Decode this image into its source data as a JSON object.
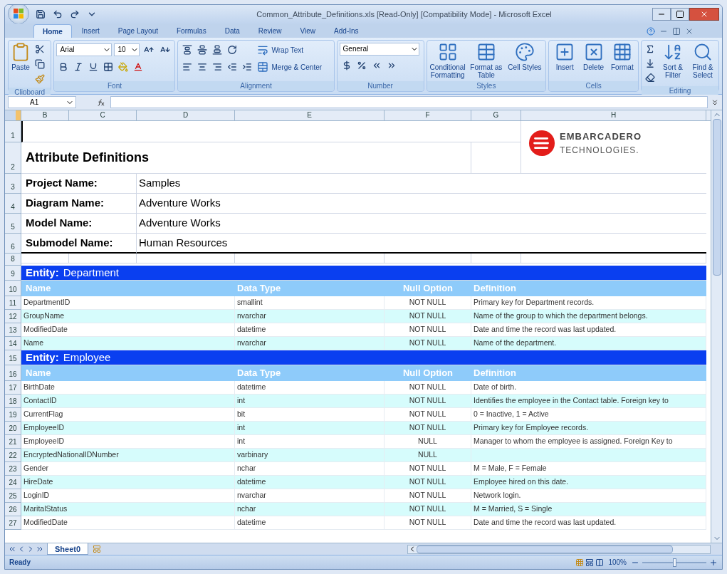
{
  "window": {
    "title": "Common_Attribute_Definitions.xls  [Read-Only]  [Compatibility Mode] - Microsoft Excel"
  },
  "ribbon_tabs": [
    {
      "label": "Home",
      "selected": true
    },
    {
      "label": "Insert",
      "selected": false
    },
    {
      "label": "Page Layout",
      "selected": false
    },
    {
      "label": "Formulas",
      "selected": false
    },
    {
      "label": "Data",
      "selected": false
    },
    {
      "label": "Review",
      "selected": false
    },
    {
      "label": "View",
      "selected": false
    },
    {
      "label": "Add-Ins",
      "selected": false
    }
  ],
  "clipboard": {
    "paste": "Paste",
    "label": "Clipboard"
  },
  "font": {
    "name": "Arial",
    "size": "10",
    "label": "Font"
  },
  "alignment": {
    "wrap": "Wrap Text",
    "merge": "Merge & Center",
    "label": "Alignment"
  },
  "number": {
    "format": "General",
    "label": "Number"
  },
  "styles": {
    "buttons": [
      "Conditional Formatting",
      "Format as Table",
      "Cell Styles"
    ],
    "label": "Styles"
  },
  "cells": {
    "buttons": [
      "Insert",
      "Delete",
      "Format"
    ],
    "label": "Cells"
  },
  "editing": {
    "buttons": [
      "Sort & Filter",
      "Find & Select"
    ],
    "label": "Editing"
  },
  "name_box": "A1",
  "columns": [
    "B",
    "C",
    "D",
    "E",
    "F",
    "G",
    "H"
  ],
  "rows": [
    {
      "row": "1",
      "kind": "top",
      "logo": {
        "line1": "EMBARCADERO",
        "line2": "TECHNOLOGIES."
      }
    },
    {
      "row": "2",
      "kind": "title",
      "text": "Attribute Definitions"
    },
    {
      "row": "3",
      "kind": "field",
      "label": "Project Name:",
      "value": "Samples"
    },
    {
      "row": "4",
      "kind": "field",
      "label": "Diagram Name:",
      "value": "Adventure Works"
    },
    {
      "row": "5",
      "kind": "field",
      "label": "Model Name:",
      "value": "Adventure Works"
    },
    {
      "row": "6",
      "kind": "field",
      "label": "Submodel Name:",
      "value": "Human Resources"
    },
    {
      "row": "8",
      "kind": "spacer"
    },
    {
      "row": "9",
      "kind": "entity",
      "label": "Entity:",
      "value": "Department"
    },
    {
      "row": "10",
      "kind": "header",
      "name": "Name",
      "type": "Data Type",
      "null": "Null Option",
      "definition": "Definition"
    },
    {
      "row": "11",
      "kind": "data",
      "shaded": false,
      "name": "DepartmentID",
      "type": "smallint",
      "null": "NOT NULL",
      "definition": "Primary key for Department records."
    },
    {
      "row": "12",
      "kind": "data",
      "shaded": true,
      "name": "GroupName",
      "type": "nvarchar",
      "null": "NOT NULL",
      "definition": "Name of the group to which the department belongs."
    },
    {
      "row": "13",
      "kind": "data",
      "shaded": false,
      "name": "ModifiedDate",
      "type": "datetime",
      "null": "NOT NULL",
      "definition": "Date and time the record was last updated."
    },
    {
      "row": "14",
      "kind": "data",
      "shaded": true,
      "name": "Name",
      "type": "nvarchar",
      "null": "NOT NULL",
      "definition": "Name of the department."
    },
    {
      "row": "15",
      "kind": "entity",
      "label": "Entity:",
      "value": "Employee"
    },
    {
      "row": "16",
      "kind": "header",
      "name": "Name",
      "type": "Data Type",
      "null": "Null Option",
      "definition": "Definition"
    },
    {
      "row": "17",
      "kind": "data",
      "shaded": false,
      "name": "BirthDate",
      "type": "datetime",
      "null": "NOT NULL",
      "definition": "Date of birth."
    },
    {
      "row": "18",
      "kind": "data",
      "shaded": true,
      "name": "ContactID",
      "type": "int",
      "null": "NOT NULL",
      "definition": "Identifies the employee in the Contact table. Foreign key to"
    },
    {
      "row": "19",
      "kind": "data",
      "shaded": false,
      "name": "CurrentFlag",
      "type": "bit",
      "null": "NOT NULL",
      "definition": "0 = Inactive, 1 = Active"
    },
    {
      "row": "20",
      "kind": "data",
      "shaded": true,
      "name": "EmployeeID",
      "type": "int",
      "null": "NOT NULL",
      "definition": "Primary key for Employee records."
    },
    {
      "row": "21",
      "kind": "data",
      "shaded": false,
      "name": "EmployeeID",
      "type": "int",
      "null": "NULL",
      "definition": "Manager to whom the employee is assigned. Foreign Key to"
    },
    {
      "row": "22",
      "kind": "data",
      "shaded": true,
      "name": "EncryptedNationalIDNumber",
      "type": "varbinary",
      "null": "NULL"
    },
    {
      "row": "23",
      "kind": "data",
      "shaded": false,
      "name": "Gender",
      "type": "nchar",
      "null": "NOT NULL",
      "definition": "M = Male, F = Female"
    },
    {
      "row": "24",
      "kind": "data",
      "shaded": true,
      "name": "HireDate",
      "type": "datetime",
      "null": "NOT NULL",
      "definition": "Employee hired on this date."
    },
    {
      "row": "25",
      "kind": "data",
      "shaded": false,
      "name": "LoginID",
      "type": "nvarchar",
      "null": "NOT NULL",
      "definition": "Network login."
    },
    {
      "row": "26",
      "kind": "data",
      "shaded": true,
      "name": "MaritalStatus",
      "type": "nchar",
      "null": "NOT NULL",
      "definition": "M = Married, S = Single"
    },
    {
      "row": "27",
      "kind": "data",
      "shaded": false,
      "name": "ModifiedDate",
      "type": "datetime",
      "null": "NOT NULL",
      "definition": "Date and time the record was last updated."
    }
  ],
  "sheet_tabs": [
    {
      "label": "Sheet0",
      "selected": true
    }
  ],
  "status_bar": {
    "text": "Ready",
    "zoom": "100%",
    "zoom_slider": {
      "level": 0.5
    }
  }
}
